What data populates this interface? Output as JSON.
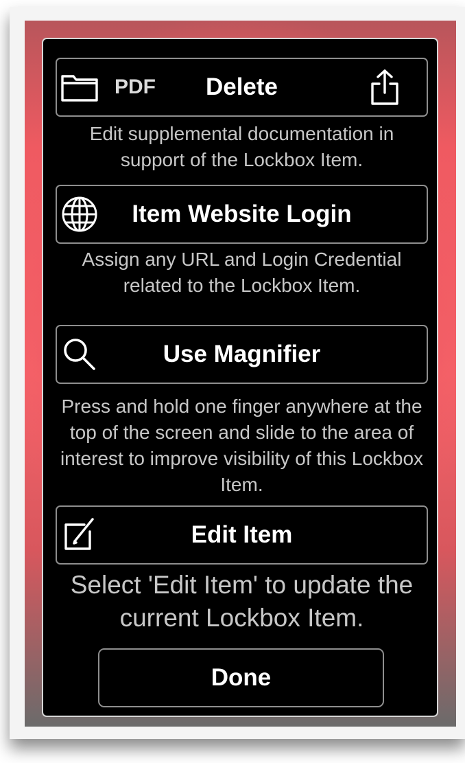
{
  "colors": {
    "panel_background": "#000000",
    "button_border": "#8e8e8e",
    "text_primary": "#ffffff",
    "text_secondary": "#c7c7c7",
    "backdrop_red": "#f05a62"
  },
  "document_row": {
    "folder_icon": "folder-icon",
    "pdf_label": "PDF",
    "delete_label": "Delete",
    "share_icon": "share-icon",
    "description": "Edit supplemental documentation in support of the Lockbox Item."
  },
  "website_row": {
    "icon": "globe-icon",
    "label": "Item Website Login",
    "description": "Assign any URL and Login Credential related to the Lockbox Item."
  },
  "magnifier_row": {
    "icon": "magnifier-icon",
    "label": "Use Magnifier",
    "description": "Press and hold one finger anywhere at the top of the screen and slide to the area of interest to improve visibility of this Lockbox Item."
  },
  "edit_row": {
    "icon": "edit-icon",
    "label": "Edit Item",
    "description": "Select 'Edit Item' to update the current Lockbox Item."
  },
  "done_label": "Done"
}
